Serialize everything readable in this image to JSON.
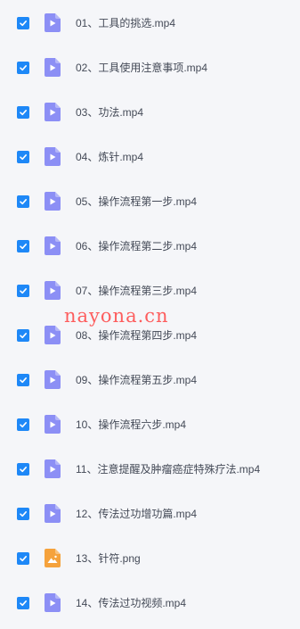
{
  "files": [
    {
      "name": "01、工具的挑选.mp4",
      "type": "video",
      "checked": true
    },
    {
      "name": "02、工具使用注意事项.mp4",
      "type": "video",
      "checked": true
    },
    {
      "name": "03、功法.mp4",
      "type": "video",
      "checked": true
    },
    {
      "name": "04、炼针.mp4",
      "type": "video",
      "checked": true
    },
    {
      "name": "05、操作流程第一步.mp4",
      "type": "video",
      "checked": true
    },
    {
      "name": "06、操作流程第二步.mp4",
      "type": "video",
      "checked": true
    },
    {
      "name": "07、操作流程第三步.mp4",
      "type": "video",
      "checked": true
    },
    {
      "name": "08、操作流程第四步.mp4",
      "type": "video",
      "checked": true
    },
    {
      "name": "09、操作流程第五步.mp4",
      "type": "video",
      "checked": true
    },
    {
      "name": "10、操作流程六步.mp4",
      "type": "video",
      "checked": true
    },
    {
      "name": "11、注意提醒及肿瘤癌症特殊疗法.mp4",
      "type": "video",
      "checked": true
    },
    {
      "name": "12、传法过功增功篇.mp4",
      "type": "video",
      "checked": true
    },
    {
      "name": "13、针符.png",
      "type": "image",
      "checked": true
    },
    {
      "name": "14、传法过功视频.mp4",
      "type": "video",
      "checked": true
    }
  ],
  "watermark": "nayona.cn",
  "colors": {
    "checkbox": "#1e88f7",
    "video_icon": "#8c8ff5",
    "image_icon": "#f5a23c",
    "text": "#444a57",
    "watermark": "#ff3c3c"
  }
}
